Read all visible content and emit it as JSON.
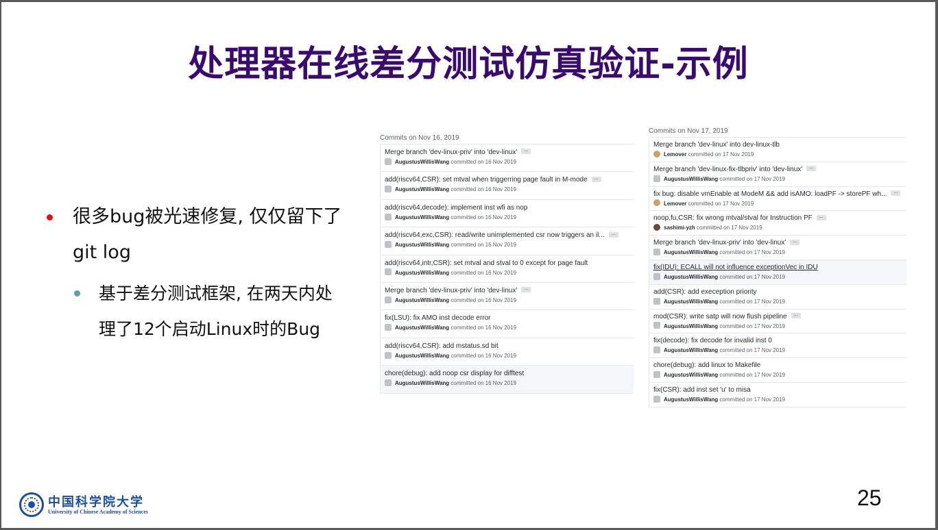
{
  "slide": {
    "title": "处理器在线差分测试仿真验证-示例",
    "page_number": "25"
  },
  "bullets": {
    "level1_line1": "很多bug被光速修复, 仅仅留下了",
    "level1_line2": "git log",
    "level2_line1": "基于差分测试框架, 在两天内处",
    "level2_line2": "理了12个启动Linux时的Bug",
    "level1_color": "#e0101a",
    "level2_color": "#5aa3a0"
  },
  "commits_left": {
    "heading": "Commits on Nov 16, 2019",
    "items": [
      {
        "message": "Merge branch 'dev-linux-priv' into 'dev-linux'",
        "author": "AugustusWillisWang",
        "date": "committed on 16 Nov 2019"
      },
      {
        "message": "add(riscv64,CSR): set mtval when triggerring page fault in M-mode",
        "author": "AugustusWillisWang",
        "date": "committed on 16 Nov 2019"
      },
      {
        "message": "add(riscv64,decode): implement inst wfi as nop",
        "author": "AugustusWillisWang",
        "date": "committed on 16 Nov 2019"
      },
      {
        "message": "add(riscv64,exc,CSR): read/write unimplemented csr now triggers an il...",
        "author": "AugustusWillisWang",
        "date": "committed on 16 Nov 2019"
      },
      {
        "message": "add(riscv64,intr,CSR): set mtval and stval to 0 except for page fault",
        "author": "AugustusWillisWang",
        "date": "committed on 16 Nov 2019"
      },
      {
        "message": "Merge branch 'dev-linux-priv' into 'dev-linux'",
        "author": "AugustusWillisWang",
        "date": "committed on 16 Nov 2019"
      },
      {
        "message": "fix(LSU): fix AMO inst decode error",
        "author": "AugustusWillisWang",
        "date": "committed on 16 Nov 2019"
      },
      {
        "message": "add(riscv64,CSR): add mstatus.sd bit",
        "author": "AugustusWillisWang",
        "date": "committed on 16 Nov 2019"
      },
      {
        "message": "chore(debug): add noop csr display for difftest",
        "author": "AugustusWillisWang",
        "date": "committed on 16 Nov 2019"
      }
    ]
  },
  "commits_right": {
    "heading": "Commits on Nov 17, 2019",
    "items": [
      {
        "message": "Merge branch 'dev-linux' into dev-linux-tlb",
        "author": "Lemover",
        "date": "committed on 17 Nov 2019"
      },
      {
        "message": "Merge branch 'dev-linux-fix-tlbpriv' into 'dev-linux'",
        "author": "AugustusWillisWang",
        "date": "committed on 17 Nov 2019"
      },
      {
        "message": "fix bug: disable vmEnable at ModeM && add isAMO: loadPF -> storePF wh...",
        "author": "Lemover",
        "date": "committed on 17 Nov 2019"
      },
      {
        "message": "noop,fu,CSR: fix wrong mtval/stval for Instruction PF",
        "author": "sashimi-yzh",
        "date": "committed on 17 Nov 2019"
      },
      {
        "message": "Merge branch 'dev-linux-priv' into 'dev-linux'",
        "author": "AugustusWillisWang",
        "date": "committed on 17 Nov 2019"
      },
      {
        "message": "fix(IDU): ECALL will not influence exceptionVec in IDU",
        "author": "AugustusWillisWang",
        "date": "committed on 17 Nov 2019"
      },
      {
        "message": "add(CSR): add exeception priority",
        "author": "AugustusWillisWang",
        "date": "committed on 17 Nov 2019"
      },
      {
        "message": "mod(CSR): write satp will now flush pipeline",
        "author": "AugustusWillisWang",
        "date": "committed on 17 Nov 2019"
      },
      {
        "message": "fix(decode): fix decode for invalid inst 0",
        "author": "AugustusWillisWang",
        "date": "committed on 17 Nov 2019"
      },
      {
        "message": "chore(debug): add linux to Makefile",
        "author": "AugustusWillisWang",
        "date": "committed on 17 Nov 2019"
      },
      {
        "message": "fix(CSR): add inst set 'u' to misa",
        "author": "AugustusWillisWang",
        "date": "committed on 17 Nov 2019"
      }
    ]
  },
  "logo": {
    "name_cn": "中国科学院大学",
    "name_en": "University of Chinese Academy of Sciences",
    "brand_color": "#1d4e9e"
  },
  "ellipsis_label": "..."
}
